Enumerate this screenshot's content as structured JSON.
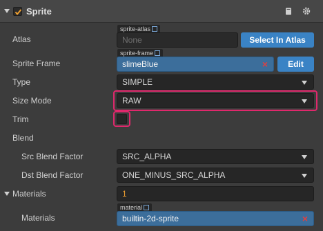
{
  "header": {
    "title": "Sprite",
    "enabled": true
  },
  "atlas": {
    "label": "Atlas",
    "tag": "sprite-atlas",
    "value": "None",
    "button": "Select In Atlas"
  },
  "sprite_frame": {
    "label": "Sprite Frame",
    "tag": "sprite-frame",
    "value": "slimeBlue",
    "button": "Edit",
    "clear_glyph": "×"
  },
  "type": {
    "label": "Type",
    "value": "SIMPLE"
  },
  "size_mode": {
    "label": "Size Mode",
    "value": "RAW"
  },
  "trim": {
    "label": "Trim",
    "checked": false
  },
  "blend": {
    "label": "Blend",
    "src_label": "Src Blend Factor",
    "src_value": "SRC_ALPHA",
    "dst_label": "Dst Blend Factor",
    "dst_value": "ONE_MINUS_SRC_ALPHA"
  },
  "materials": {
    "label": "Materials",
    "count": "1",
    "item_label": "Materials",
    "tag": "material",
    "value": "builtin-2d-sprite",
    "clear_glyph": "×"
  },
  "colors": {
    "accent": "#3a83c5",
    "asset": "#3c6e9b",
    "highlight": "#e0286c",
    "check": "#f0a030"
  },
  "icons": [
    "collapse-arrow-icon",
    "checkbox-icon",
    "book-icon",
    "gear-icon",
    "link-icon",
    "clear-icon",
    "dropdown-caret-icon"
  ]
}
